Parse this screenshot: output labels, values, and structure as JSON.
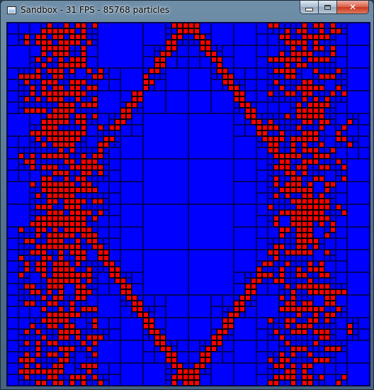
{
  "window": {
    "title": "Sandbox - 31 FPS - 85768 particles",
    "app_icon": "application-window-icon",
    "controls": {
      "minimize_icon": "minimize-icon",
      "maximize_icon": "maximize-icon",
      "close_icon": "close-icon",
      "close_glyph": "✕"
    }
  },
  "simulation": {
    "grid_cells": 64,
    "colors": {
      "background": "#0000ff",
      "particle": "#ff0000",
      "cell_border": "#000000"
    }
  }
}
